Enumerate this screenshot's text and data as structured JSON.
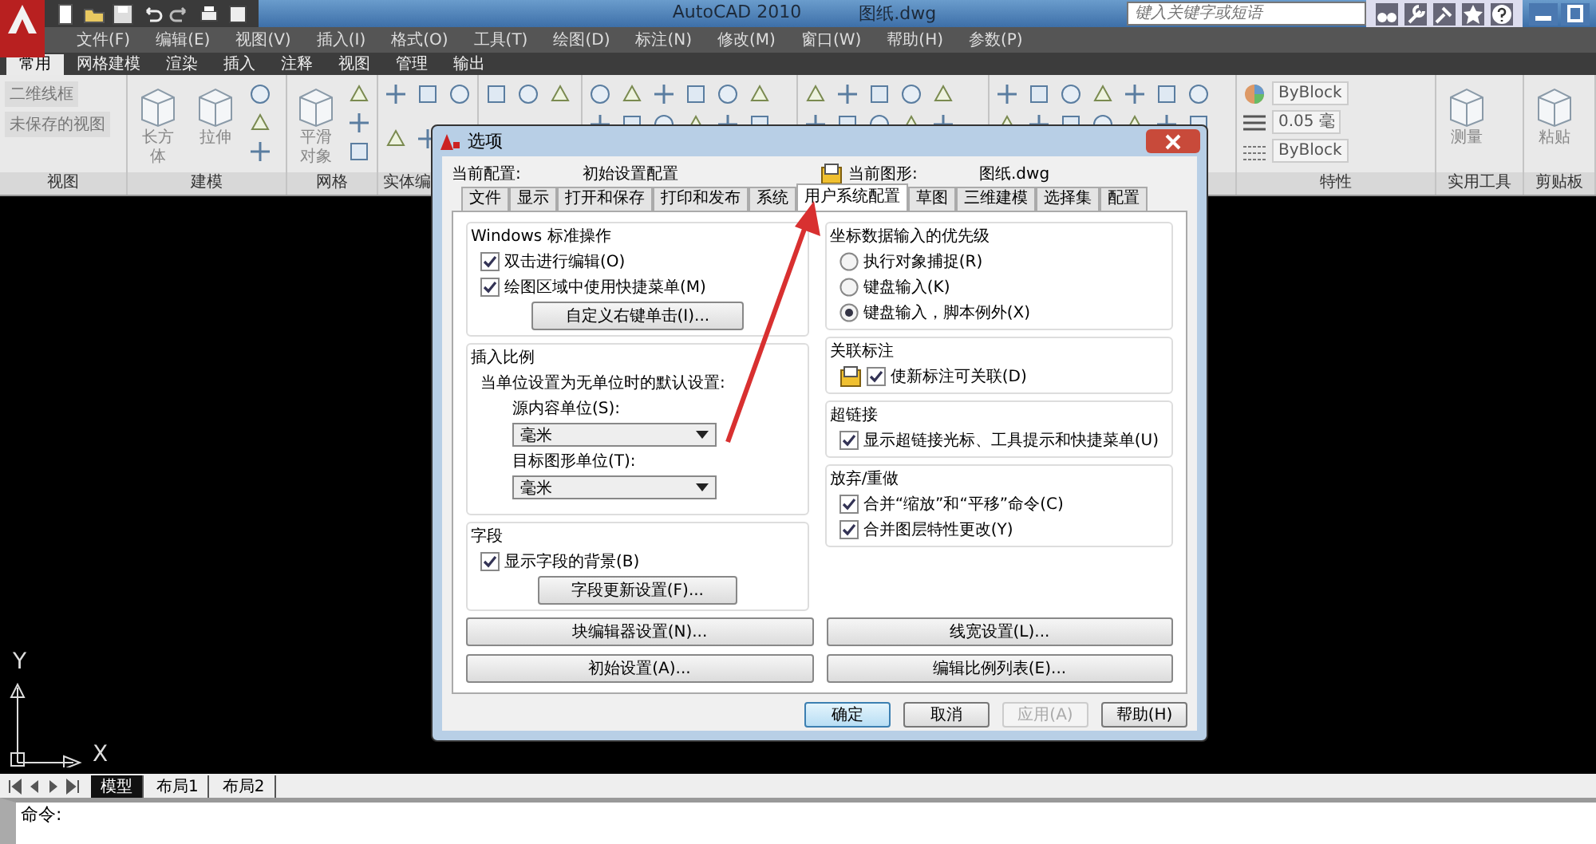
{
  "app": {
    "title": "AutoCAD 2010",
    "file": "图纸.dwg",
    "search": {
      "placeholder": "键入关键字或短语"
    }
  },
  "menu": [
    "文件(F)",
    "编辑(E)",
    "视图(V)",
    "插入(I)",
    "格式(O)",
    "工具(T)",
    "绘图(D)",
    "标注(N)",
    "修改(M)",
    "窗口(W)",
    "帮助(H)",
    "参数(P)"
  ],
  "ribbon_tabs": [
    {
      "label": "常用",
      "selected": true
    },
    {
      "label": "网格建模",
      "selected": false
    },
    {
      "label": "渲染",
      "selected": false
    },
    {
      "label": "插入",
      "selected": false
    },
    {
      "label": "注释",
      "selected": false
    },
    {
      "label": "视图",
      "selected": false
    },
    {
      "label": "管理",
      "selected": false
    },
    {
      "label": "输出",
      "selected": false
    }
  ],
  "ribbon_panels": [
    {
      "kind": "view",
      "title": "视图",
      "dropdowns": [
        "二维线框",
        "未保存的视图"
      ]
    },
    {
      "kind": "tools",
      "title": "建模",
      "tools": [
        "长方体",
        "拉伸"
      ]
    },
    {
      "kind": "tools",
      "title": "网格",
      "tools": [
        "平滑对象"
      ]
    },
    {
      "kind": "icons",
      "title": "实体编"
    },
    {
      "kind": "icons"
    },
    {
      "kind": "icons"
    },
    {
      "kind": "icons"
    },
    {
      "kind": "icons"
    },
    {
      "kind": "properties",
      "title": "特性",
      "rows": [
        "ByBlock",
        "0.05 毫",
        "ByBlock"
      ]
    },
    {
      "kind": "tools",
      "title": "实用工具",
      "tools": [
        "测量"
      ]
    },
    {
      "kind": "tools",
      "title": "剪贴板",
      "tools": [
        "粘贴"
      ]
    }
  ],
  "ucs": {
    "y": "Y",
    "x": "X"
  },
  "layout_tabs": [
    {
      "label": "模型",
      "selected": true
    },
    {
      "label": "布局1",
      "selected": false
    },
    {
      "label": "布局2",
      "selected": false
    }
  ],
  "command_line": {
    "prompt": "命令:"
  },
  "dialog": {
    "title": "选项",
    "profile_label": "当前配置:",
    "profile": "初始设置配置",
    "drawing_label": "当前图形:",
    "drawing": "图纸.dwg",
    "tabs": [
      {
        "label": "文件",
        "selected": false
      },
      {
        "label": "显示",
        "selected": false
      },
      {
        "label": "打开和保存",
        "selected": false
      },
      {
        "label": "打印和发布",
        "selected": false
      },
      {
        "label": "系统",
        "selected": false
      },
      {
        "label": "用户系统配置",
        "selected": true
      },
      {
        "label": "草图",
        "selected": false
      },
      {
        "label": "三维建模",
        "selected": false
      },
      {
        "label": "选择集",
        "selected": false
      },
      {
        "label": "配置",
        "selected": false
      }
    ],
    "left_groups": [
      {
        "title": "Windows 标准操作",
        "items": [
          {
            "kind": "checkbox",
            "label": "双击进行编辑(O)",
            "checked": true
          },
          {
            "kind": "checkbox",
            "label": "绘图区域中使用快捷菜单(M)",
            "checked": true
          },
          {
            "kind": "button",
            "label": "自定义右键单击(I)..."
          }
        ]
      },
      {
        "title": "插入比例",
        "items": [
          {
            "kind": "text",
            "text": "当单位设置为无单位时的默认设置:"
          },
          {
            "kind": "label",
            "text": "源内容单位(S):"
          },
          {
            "kind": "select",
            "value": "毫米"
          },
          {
            "kind": "label",
            "text": "目标图形单位(T):"
          },
          {
            "kind": "select",
            "value": "毫米"
          }
        ]
      },
      {
        "title": "字段",
        "items": [
          {
            "kind": "checkbox",
            "label": "显示字段的背景(B)",
            "checked": true
          },
          {
            "kind": "button",
            "label": "字段更新设置(F)..."
          }
        ]
      }
    ],
    "right_groups": [
      {
        "title": "坐标数据输入的优先级",
        "items": [
          {
            "kind": "radio",
            "label": "执行对象捕捉(R)",
            "selected": false
          },
          {
            "kind": "radio",
            "label": "键盘输入(K)",
            "selected": false
          },
          {
            "kind": "radio",
            "label": "键盘输入，脚本例外(X)",
            "selected": true
          }
        ]
      },
      {
        "title": "关联标注",
        "items": [
          {
            "kind": "iconcheck",
            "label": "使新标注可关联(D)",
            "checked": true
          }
        ]
      },
      {
        "title": "超链接",
        "items": [
          {
            "kind": "checkbox",
            "label": "显示超链接光标、工具提示和快捷菜单(U)",
            "checked": true
          }
        ]
      },
      {
        "title": "放弃/重做",
        "items": [
          {
            "kind": "checkbox",
            "label": "合并“缩放”和“平移”命令(C)",
            "checked": true
          },
          {
            "kind": "checkbox",
            "label": "合并图层特性更改(Y)",
            "checked": true
          }
        ]
      }
    ],
    "wide_buttons": [
      "块编辑器设置(N)...",
      "线宽设置(L)...",
      "初始设置(A)...",
      "编辑比例列表(E)..."
    ],
    "footer_buttons": [
      {
        "label": "确定",
        "default": true,
        "disabled": false
      },
      {
        "label": "取消",
        "default": false,
        "disabled": false
      },
      {
        "label": "应用(A)",
        "default": false,
        "disabled": true
      },
      {
        "label": "帮助(H)",
        "default": false,
        "disabled": false
      }
    ]
  }
}
